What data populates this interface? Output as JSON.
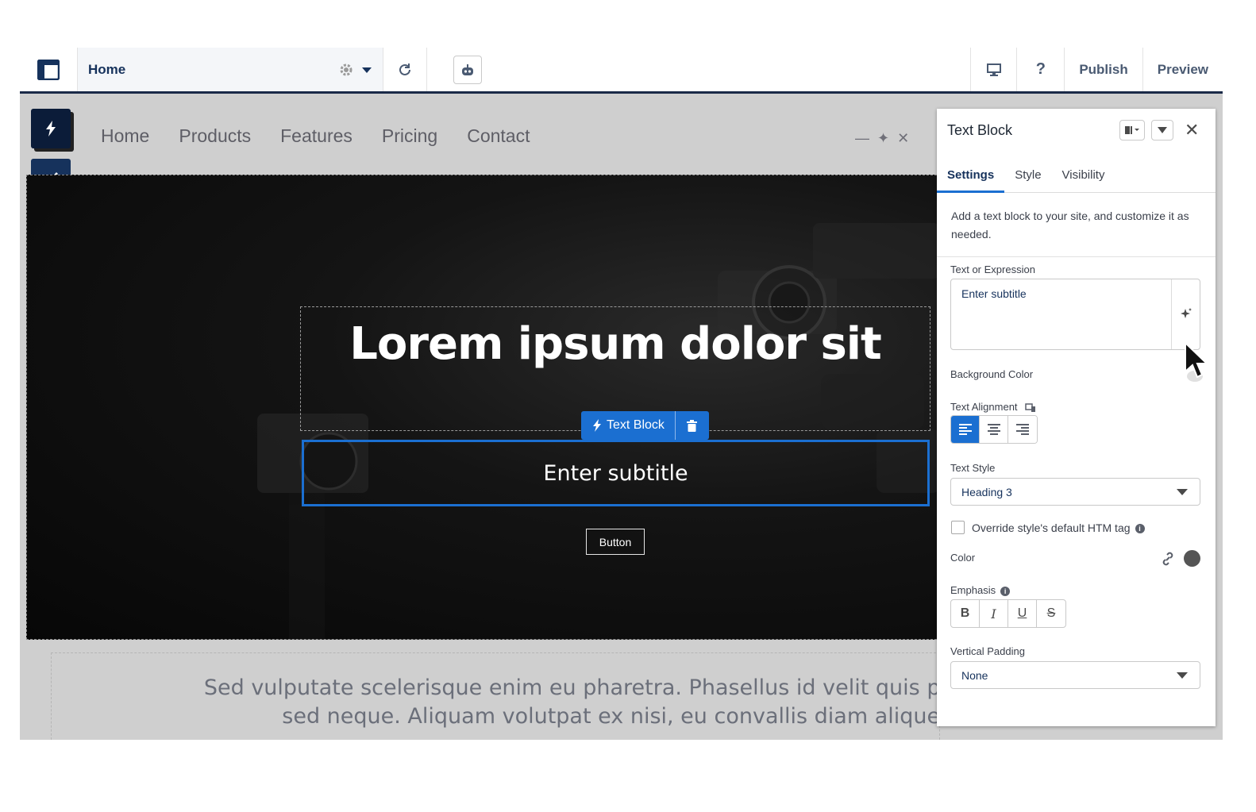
{
  "toolbar": {
    "page_label": "Home",
    "publish_label": "Publish",
    "preview_label": "Preview",
    "help_label": "?"
  },
  "site_nav": {
    "items": [
      "Home",
      "Products",
      "Features",
      "Pricing",
      "Contact"
    ]
  },
  "hero": {
    "title": "Lorem ipsum dolor sit",
    "subtitle": "Enter subtitle",
    "button_label": "Button",
    "chip_label": "Text Block"
  },
  "paragraph": {
    "line1": "Sed vulputate scelerisque enim eu pharetra. Phasellus id velit quis purus ele",
    "line2": "sed neque. Aliquam volutpat ex nisi, eu convallis diam aliquet"
  },
  "panel": {
    "title": "Text Block",
    "tabs": [
      "Settings",
      "Style",
      "Visibility"
    ],
    "active_tab": "Settings",
    "description": "Add a text block to your site, and customize it as needed.",
    "text_expression_label": "Text or Expression",
    "text_expression_value": "Enter subtitle",
    "background_color_label": "Background Color",
    "text_alignment_label": "Text Alignment",
    "text_style_label": "Text Style",
    "text_style_value": "Heading 3",
    "override_label": "Override style's default HTM tag",
    "color_label": "Color",
    "emphasis_label": "Emphasis",
    "emphasis_buttons": [
      "B",
      "I",
      "U",
      "S"
    ],
    "vertical_padding_label": "Vertical Padding",
    "vertical_padding_value": "None"
  },
  "colors": {
    "accent": "#1b6fd1",
    "navy": "#16325c",
    "swatch": "#555555"
  }
}
